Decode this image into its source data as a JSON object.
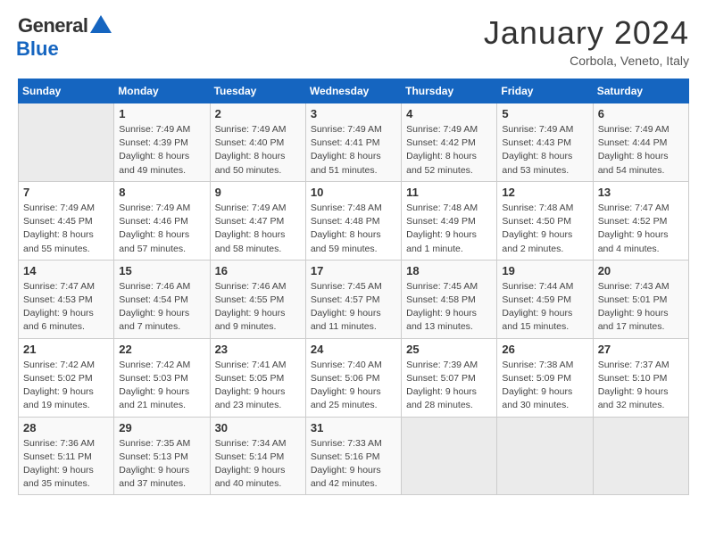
{
  "logo": {
    "general": "General",
    "blue": "Blue"
  },
  "title": "January 2024",
  "subtitle": "Corbola, Veneto, Italy",
  "days_of_week": [
    "Sunday",
    "Monday",
    "Tuesday",
    "Wednesday",
    "Thursday",
    "Friday",
    "Saturday"
  ],
  "weeks": [
    [
      {
        "day": "",
        "sunrise": "",
        "sunset": "",
        "daylight": ""
      },
      {
        "day": "1",
        "sunrise": "Sunrise: 7:49 AM",
        "sunset": "Sunset: 4:39 PM",
        "daylight": "Daylight: 8 hours and 49 minutes."
      },
      {
        "day": "2",
        "sunrise": "Sunrise: 7:49 AM",
        "sunset": "Sunset: 4:40 PM",
        "daylight": "Daylight: 8 hours and 50 minutes."
      },
      {
        "day": "3",
        "sunrise": "Sunrise: 7:49 AM",
        "sunset": "Sunset: 4:41 PM",
        "daylight": "Daylight: 8 hours and 51 minutes."
      },
      {
        "day": "4",
        "sunrise": "Sunrise: 7:49 AM",
        "sunset": "Sunset: 4:42 PM",
        "daylight": "Daylight: 8 hours and 52 minutes."
      },
      {
        "day": "5",
        "sunrise": "Sunrise: 7:49 AM",
        "sunset": "Sunset: 4:43 PM",
        "daylight": "Daylight: 8 hours and 53 minutes."
      },
      {
        "day": "6",
        "sunrise": "Sunrise: 7:49 AM",
        "sunset": "Sunset: 4:44 PM",
        "daylight": "Daylight: 8 hours and 54 minutes."
      }
    ],
    [
      {
        "day": "7",
        "sunrise": "Sunrise: 7:49 AM",
        "sunset": "Sunset: 4:45 PM",
        "daylight": "Daylight: 8 hours and 55 minutes."
      },
      {
        "day": "8",
        "sunrise": "Sunrise: 7:49 AM",
        "sunset": "Sunset: 4:46 PM",
        "daylight": "Daylight: 8 hours and 57 minutes."
      },
      {
        "day": "9",
        "sunrise": "Sunrise: 7:49 AM",
        "sunset": "Sunset: 4:47 PM",
        "daylight": "Daylight: 8 hours and 58 minutes."
      },
      {
        "day": "10",
        "sunrise": "Sunrise: 7:48 AM",
        "sunset": "Sunset: 4:48 PM",
        "daylight": "Daylight: 8 hours and 59 minutes."
      },
      {
        "day": "11",
        "sunrise": "Sunrise: 7:48 AM",
        "sunset": "Sunset: 4:49 PM",
        "daylight": "Daylight: 9 hours and 1 minute."
      },
      {
        "day": "12",
        "sunrise": "Sunrise: 7:48 AM",
        "sunset": "Sunset: 4:50 PM",
        "daylight": "Daylight: 9 hours and 2 minutes."
      },
      {
        "day": "13",
        "sunrise": "Sunrise: 7:47 AM",
        "sunset": "Sunset: 4:52 PM",
        "daylight": "Daylight: 9 hours and 4 minutes."
      }
    ],
    [
      {
        "day": "14",
        "sunrise": "Sunrise: 7:47 AM",
        "sunset": "Sunset: 4:53 PM",
        "daylight": "Daylight: 9 hours and 6 minutes."
      },
      {
        "day": "15",
        "sunrise": "Sunrise: 7:46 AM",
        "sunset": "Sunset: 4:54 PM",
        "daylight": "Daylight: 9 hours and 7 minutes."
      },
      {
        "day": "16",
        "sunrise": "Sunrise: 7:46 AM",
        "sunset": "Sunset: 4:55 PM",
        "daylight": "Daylight: 9 hours and 9 minutes."
      },
      {
        "day": "17",
        "sunrise": "Sunrise: 7:45 AM",
        "sunset": "Sunset: 4:57 PM",
        "daylight": "Daylight: 9 hours and 11 minutes."
      },
      {
        "day": "18",
        "sunrise": "Sunrise: 7:45 AM",
        "sunset": "Sunset: 4:58 PM",
        "daylight": "Daylight: 9 hours and 13 minutes."
      },
      {
        "day": "19",
        "sunrise": "Sunrise: 7:44 AM",
        "sunset": "Sunset: 4:59 PM",
        "daylight": "Daylight: 9 hours and 15 minutes."
      },
      {
        "day": "20",
        "sunrise": "Sunrise: 7:43 AM",
        "sunset": "Sunset: 5:01 PM",
        "daylight": "Daylight: 9 hours and 17 minutes."
      }
    ],
    [
      {
        "day": "21",
        "sunrise": "Sunrise: 7:42 AM",
        "sunset": "Sunset: 5:02 PM",
        "daylight": "Daylight: 9 hours and 19 minutes."
      },
      {
        "day": "22",
        "sunrise": "Sunrise: 7:42 AM",
        "sunset": "Sunset: 5:03 PM",
        "daylight": "Daylight: 9 hours and 21 minutes."
      },
      {
        "day": "23",
        "sunrise": "Sunrise: 7:41 AM",
        "sunset": "Sunset: 5:05 PM",
        "daylight": "Daylight: 9 hours and 23 minutes."
      },
      {
        "day": "24",
        "sunrise": "Sunrise: 7:40 AM",
        "sunset": "Sunset: 5:06 PM",
        "daylight": "Daylight: 9 hours and 25 minutes."
      },
      {
        "day": "25",
        "sunrise": "Sunrise: 7:39 AM",
        "sunset": "Sunset: 5:07 PM",
        "daylight": "Daylight: 9 hours and 28 minutes."
      },
      {
        "day": "26",
        "sunrise": "Sunrise: 7:38 AM",
        "sunset": "Sunset: 5:09 PM",
        "daylight": "Daylight: 9 hours and 30 minutes."
      },
      {
        "day": "27",
        "sunrise": "Sunrise: 7:37 AM",
        "sunset": "Sunset: 5:10 PM",
        "daylight": "Daylight: 9 hours and 32 minutes."
      }
    ],
    [
      {
        "day": "28",
        "sunrise": "Sunrise: 7:36 AM",
        "sunset": "Sunset: 5:11 PM",
        "daylight": "Daylight: 9 hours and 35 minutes."
      },
      {
        "day": "29",
        "sunrise": "Sunrise: 7:35 AM",
        "sunset": "Sunset: 5:13 PM",
        "daylight": "Daylight: 9 hours and 37 minutes."
      },
      {
        "day": "30",
        "sunrise": "Sunrise: 7:34 AM",
        "sunset": "Sunset: 5:14 PM",
        "daylight": "Daylight: 9 hours and 40 minutes."
      },
      {
        "day": "31",
        "sunrise": "Sunrise: 7:33 AM",
        "sunset": "Sunset: 5:16 PM",
        "daylight": "Daylight: 9 hours and 42 minutes."
      },
      {
        "day": "",
        "sunrise": "",
        "sunset": "",
        "daylight": ""
      },
      {
        "day": "",
        "sunrise": "",
        "sunset": "",
        "daylight": ""
      },
      {
        "day": "",
        "sunrise": "",
        "sunset": "",
        "daylight": ""
      }
    ]
  ]
}
